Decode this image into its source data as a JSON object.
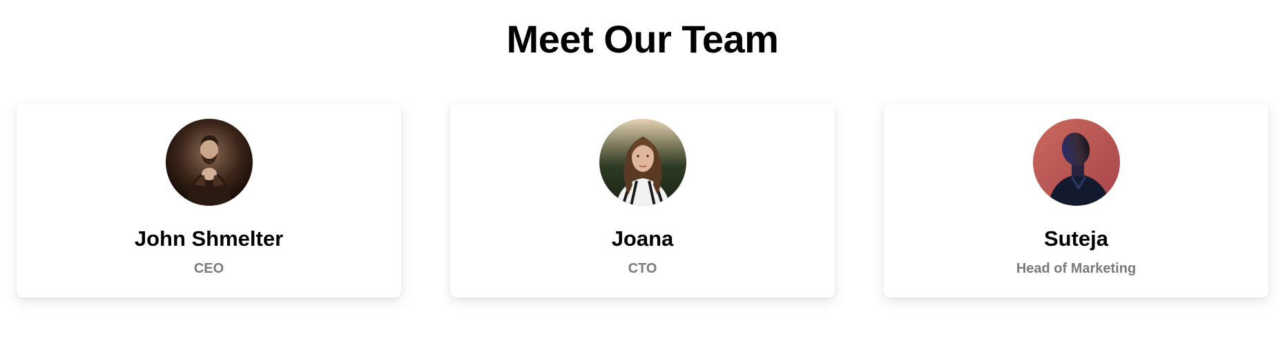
{
  "section": {
    "title": "Meet Our Team"
  },
  "team": [
    {
      "name": "John Shmelter",
      "role": "CEO",
      "avatar": "portrait-photo-man-beard"
    },
    {
      "name": "Joana",
      "role": "CTO",
      "avatar": "portrait-photo-woman"
    },
    {
      "name": "Suteja",
      "role": "Head of Marketing",
      "avatar": "portrait-photo-man-red-backdrop"
    }
  ]
}
